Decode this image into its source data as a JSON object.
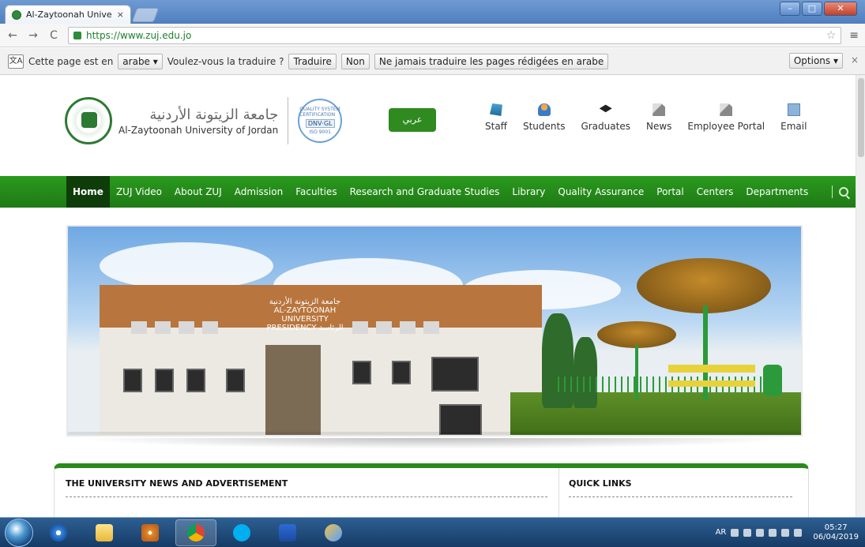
{
  "browser": {
    "tab_title": "Al-Zaytoonah University",
    "tab_close": "×",
    "url": "https://www.zuj.edu.jo"
  },
  "translate_bar": {
    "prefix": "Cette page est en",
    "language": "arabe",
    "question": "Voulez-vous la traduire ?",
    "translate_btn": "Traduire",
    "no_btn": "Non",
    "never_btn": "Ne jamais traduire les pages rédigées en arabe",
    "options_btn": "Options",
    "close": "×"
  },
  "header": {
    "logo_arabic": "جامعة الزيتونة الأردنية",
    "logo_english": "Al-Zaytoonah University of Jordan",
    "cert_top": "QUALITY SYSTEM CERTIFICATION",
    "cert_mid": "DNV·GL",
    "cert_bot": "ISO 9001",
    "arabic_button": "عربي",
    "quick_links": [
      {
        "label": "Staff",
        "icon": "staff-icon"
      },
      {
        "label": "Students",
        "icon": "students-icon"
      },
      {
        "label": "Graduates",
        "icon": "graduates-icon"
      },
      {
        "label": "News",
        "icon": "news-icon"
      },
      {
        "label": "Employee Portal",
        "icon": "portal-icon"
      },
      {
        "label": "Email",
        "icon": "email-icon"
      }
    ]
  },
  "nav": {
    "items": [
      "Home",
      "ZUJ Video",
      "About ZUJ",
      "Admission",
      "Faculties",
      "Research and Graduate Studies",
      "Library",
      "Quality Assurance",
      "Portal",
      "Centers",
      "Departments"
    ],
    "active_index": 0
  },
  "hero": {
    "building_sign_arabic": "جامعة الزيتونة الأردنية",
    "building_sign_english": "AL-ZAYTOONAH UNIVERSITY",
    "presidency_english": "PRESIDENCY",
    "presidency_arabic": "الرئاسة"
  },
  "panel": {
    "news_title": "THE UNIVERSITY NEWS AND ADVERTISEMENT",
    "quick_links_title": "QUICK LINKS"
  },
  "taskbar": {
    "lang": "AR",
    "time": "05:27",
    "date": "06/04/2019"
  },
  "colors": {
    "nav_green": "#2a9a1d",
    "nav_active": "#0e3d0a",
    "url_green": "#1a7f2c"
  }
}
